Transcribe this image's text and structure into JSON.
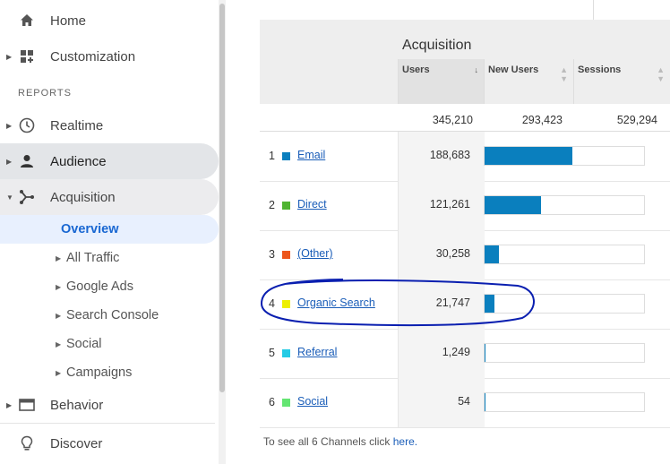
{
  "sidebar": {
    "home": "Home",
    "customization": "Customization",
    "reports_heading": "REPORTS",
    "realtime": "Realtime",
    "audience": "Audience",
    "acquisition": "Acquisition",
    "acquisition_subitems": [
      "Overview",
      "All Traffic",
      "Google Ads",
      "Search Console",
      "Social",
      "Campaigns"
    ],
    "behavior": "Behavior",
    "discover": "Discover"
  },
  "report": {
    "group_title": "Acquisition",
    "columns": [
      "Users",
      "New Users",
      "Sessions"
    ],
    "sort_indicator": "↓",
    "totals": {
      "users": "345,210",
      "new_users": "293,423",
      "sessions": "529,294"
    },
    "rows": [
      {
        "rank": "1",
        "name": "Email",
        "users": "188,683",
        "color": "#0a7fbe",
        "share": 1.0
      },
      {
        "rank": "2",
        "name": "Direct",
        "users": "121,261",
        "color": "#50b432",
        "share": 0.643
      },
      {
        "rank": "3",
        "name": "(Other)",
        "users": "30,258",
        "color": "#ed561b",
        "share": 0.16
      },
      {
        "rank": "4",
        "name": "Organic Search",
        "users": "21,747",
        "color": "#edef00",
        "share": 0.115
      },
      {
        "rank": "5",
        "name": "Referral",
        "users": "1,249",
        "color": "#24cbe5",
        "share": 0.007
      },
      {
        "rank": "6",
        "name": "Social",
        "users": "54",
        "color": "#64e572",
        "share": 0.0003
      }
    ],
    "footer_text": "To see all 6 Channels click ",
    "footer_link": "here."
  }
}
